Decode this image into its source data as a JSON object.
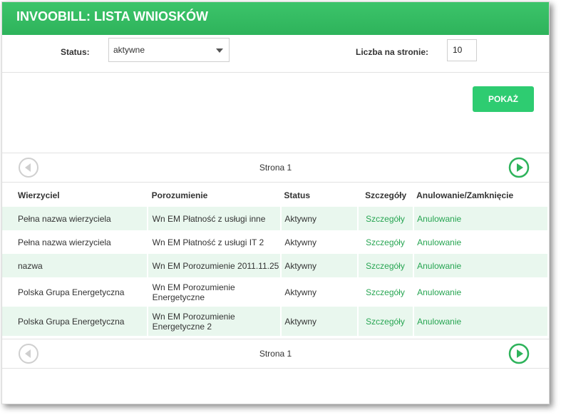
{
  "title": "INVOOBILL: LISTA WNIOSKÓW",
  "filters": {
    "status_label": "Status:",
    "status_value": "aktywne",
    "per_page_label": "Liczba na stronie:",
    "per_page_value": "10"
  },
  "show_button": "POKAŻ",
  "pager": {
    "text": "Strona 1"
  },
  "table": {
    "headers": [
      "Wierzyciel",
      "Porozumienie",
      "Status",
      "Szczegóły",
      "Anulowanie/Zamknięcie"
    ],
    "rows": [
      [
        "Pełna nazwa wierzyciela",
        "Wn EM Płatność z usługi inne",
        "Aktywny",
        "Szczegóły",
        "Anulowanie"
      ],
      [
        "Pełna nazwa wierzyciela",
        "Wn EM Płatność z usługi IT 2",
        "Aktywny",
        "Szczegóły",
        "Anulowanie"
      ],
      [
        "nazwa",
        "Wn EM Porozumienie 2011.11.25",
        "Aktywny",
        "Szczegóły",
        "Anulowanie"
      ],
      [
        "Polska Grupa Energetyczna",
        "Wn EM Porozumienie Energetyczne",
        "Aktywny",
        "Szczegóły",
        "Anulowanie"
      ],
      [
        "Polska Grupa Energetyczna",
        "Wn EM Porozumienie Energetyczne 2",
        "Aktywny",
        "Szczegóły",
        "Anulowanie"
      ]
    ]
  },
  "colors": {
    "accent": "#2ecc71",
    "link": "#27a552",
    "row_alt": "#e9f7ee"
  },
  "icons": {
    "prev": "circle-arrow-left-icon",
    "next": "circle-arrow-right-icon"
  }
}
